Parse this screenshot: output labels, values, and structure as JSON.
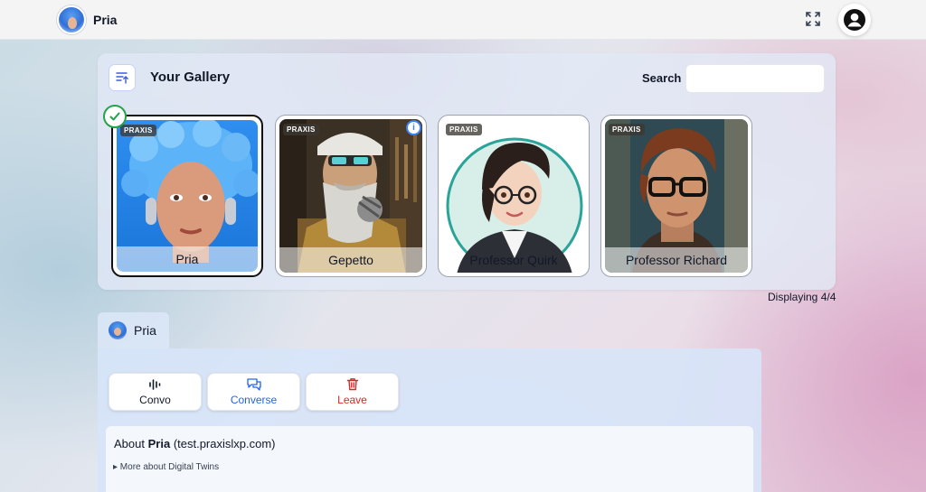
{
  "header": {
    "brand_name": "Pria"
  },
  "gallery": {
    "title": "Your Gallery",
    "search_label": "Search",
    "search_value": "",
    "displaying": "Displaying 4/4",
    "cards": [
      {
        "name": "Pria",
        "badge": "PRAXIS",
        "selected": true
      },
      {
        "name": "Gepetto",
        "badge": "PRAXIS",
        "selected": false
      },
      {
        "name": "Professor Quirk",
        "badge": "PRAXIS",
        "selected": false
      },
      {
        "name": "Professor Richard",
        "badge": "PRAXIS",
        "selected": false
      }
    ]
  },
  "agent": {
    "tab_label": "Pria",
    "actions": [
      {
        "label": "Convo",
        "color": "#111827"
      },
      {
        "label": "Converse",
        "color": "#2563eb"
      },
      {
        "label": "Leave",
        "color": "#dc2626"
      }
    ],
    "about": {
      "prefix": "About",
      "name": "Pria",
      "domain": "(test.praxislxp.com)",
      "details_toggle": "▸ More about Digital Twins"
    }
  },
  "colors": {
    "accent_blue": "#2563eb",
    "danger_red": "#dc2626",
    "selected_check": "#22a34a"
  }
}
